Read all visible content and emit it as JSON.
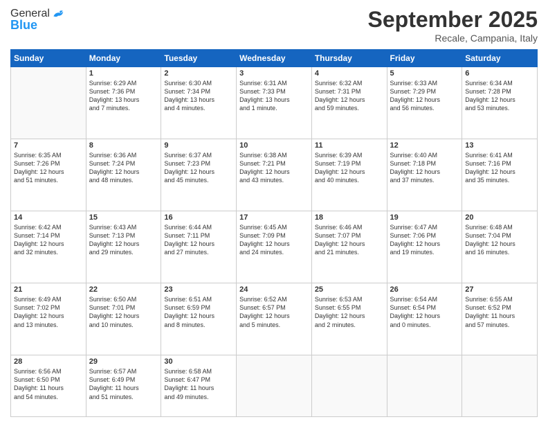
{
  "header": {
    "logo": {
      "general": "General",
      "blue": "Blue"
    },
    "title": "September 2025",
    "subtitle": "Recale, Campania, Italy"
  },
  "weekdays": [
    "Sunday",
    "Monday",
    "Tuesday",
    "Wednesday",
    "Thursday",
    "Friday",
    "Saturday"
  ],
  "weeks": [
    [
      {
        "day": "",
        "content": ""
      },
      {
        "day": "1",
        "content": "Sunrise: 6:29 AM\nSunset: 7:36 PM\nDaylight: 13 hours\nand 7 minutes."
      },
      {
        "day": "2",
        "content": "Sunrise: 6:30 AM\nSunset: 7:34 PM\nDaylight: 13 hours\nand 4 minutes."
      },
      {
        "day": "3",
        "content": "Sunrise: 6:31 AM\nSunset: 7:33 PM\nDaylight: 13 hours\nand 1 minute."
      },
      {
        "day": "4",
        "content": "Sunrise: 6:32 AM\nSunset: 7:31 PM\nDaylight: 12 hours\nand 59 minutes."
      },
      {
        "day": "5",
        "content": "Sunrise: 6:33 AM\nSunset: 7:29 PM\nDaylight: 12 hours\nand 56 minutes."
      },
      {
        "day": "6",
        "content": "Sunrise: 6:34 AM\nSunset: 7:28 PM\nDaylight: 12 hours\nand 53 minutes."
      }
    ],
    [
      {
        "day": "7",
        "content": "Sunrise: 6:35 AM\nSunset: 7:26 PM\nDaylight: 12 hours\nand 51 minutes."
      },
      {
        "day": "8",
        "content": "Sunrise: 6:36 AM\nSunset: 7:24 PM\nDaylight: 12 hours\nand 48 minutes."
      },
      {
        "day": "9",
        "content": "Sunrise: 6:37 AM\nSunset: 7:23 PM\nDaylight: 12 hours\nand 45 minutes."
      },
      {
        "day": "10",
        "content": "Sunrise: 6:38 AM\nSunset: 7:21 PM\nDaylight: 12 hours\nand 43 minutes."
      },
      {
        "day": "11",
        "content": "Sunrise: 6:39 AM\nSunset: 7:19 PM\nDaylight: 12 hours\nand 40 minutes."
      },
      {
        "day": "12",
        "content": "Sunrise: 6:40 AM\nSunset: 7:18 PM\nDaylight: 12 hours\nand 37 minutes."
      },
      {
        "day": "13",
        "content": "Sunrise: 6:41 AM\nSunset: 7:16 PM\nDaylight: 12 hours\nand 35 minutes."
      }
    ],
    [
      {
        "day": "14",
        "content": "Sunrise: 6:42 AM\nSunset: 7:14 PM\nDaylight: 12 hours\nand 32 minutes."
      },
      {
        "day": "15",
        "content": "Sunrise: 6:43 AM\nSunset: 7:13 PM\nDaylight: 12 hours\nand 29 minutes."
      },
      {
        "day": "16",
        "content": "Sunrise: 6:44 AM\nSunset: 7:11 PM\nDaylight: 12 hours\nand 27 minutes."
      },
      {
        "day": "17",
        "content": "Sunrise: 6:45 AM\nSunset: 7:09 PM\nDaylight: 12 hours\nand 24 minutes."
      },
      {
        "day": "18",
        "content": "Sunrise: 6:46 AM\nSunset: 7:07 PM\nDaylight: 12 hours\nand 21 minutes."
      },
      {
        "day": "19",
        "content": "Sunrise: 6:47 AM\nSunset: 7:06 PM\nDaylight: 12 hours\nand 19 minutes."
      },
      {
        "day": "20",
        "content": "Sunrise: 6:48 AM\nSunset: 7:04 PM\nDaylight: 12 hours\nand 16 minutes."
      }
    ],
    [
      {
        "day": "21",
        "content": "Sunrise: 6:49 AM\nSunset: 7:02 PM\nDaylight: 12 hours\nand 13 minutes."
      },
      {
        "day": "22",
        "content": "Sunrise: 6:50 AM\nSunset: 7:01 PM\nDaylight: 12 hours\nand 10 minutes."
      },
      {
        "day": "23",
        "content": "Sunrise: 6:51 AM\nSunset: 6:59 PM\nDaylight: 12 hours\nand 8 minutes."
      },
      {
        "day": "24",
        "content": "Sunrise: 6:52 AM\nSunset: 6:57 PM\nDaylight: 12 hours\nand 5 minutes."
      },
      {
        "day": "25",
        "content": "Sunrise: 6:53 AM\nSunset: 6:55 PM\nDaylight: 12 hours\nand 2 minutes."
      },
      {
        "day": "26",
        "content": "Sunrise: 6:54 AM\nSunset: 6:54 PM\nDaylight: 12 hours\nand 0 minutes."
      },
      {
        "day": "27",
        "content": "Sunrise: 6:55 AM\nSunset: 6:52 PM\nDaylight: 11 hours\nand 57 minutes."
      }
    ],
    [
      {
        "day": "28",
        "content": "Sunrise: 6:56 AM\nSunset: 6:50 PM\nDaylight: 11 hours\nand 54 minutes."
      },
      {
        "day": "29",
        "content": "Sunrise: 6:57 AM\nSunset: 6:49 PM\nDaylight: 11 hours\nand 51 minutes."
      },
      {
        "day": "30",
        "content": "Sunrise: 6:58 AM\nSunset: 6:47 PM\nDaylight: 11 hours\nand 49 minutes."
      },
      {
        "day": "",
        "content": ""
      },
      {
        "day": "",
        "content": ""
      },
      {
        "day": "",
        "content": ""
      },
      {
        "day": "",
        "content": ""
      }
    ]
  ]
}
